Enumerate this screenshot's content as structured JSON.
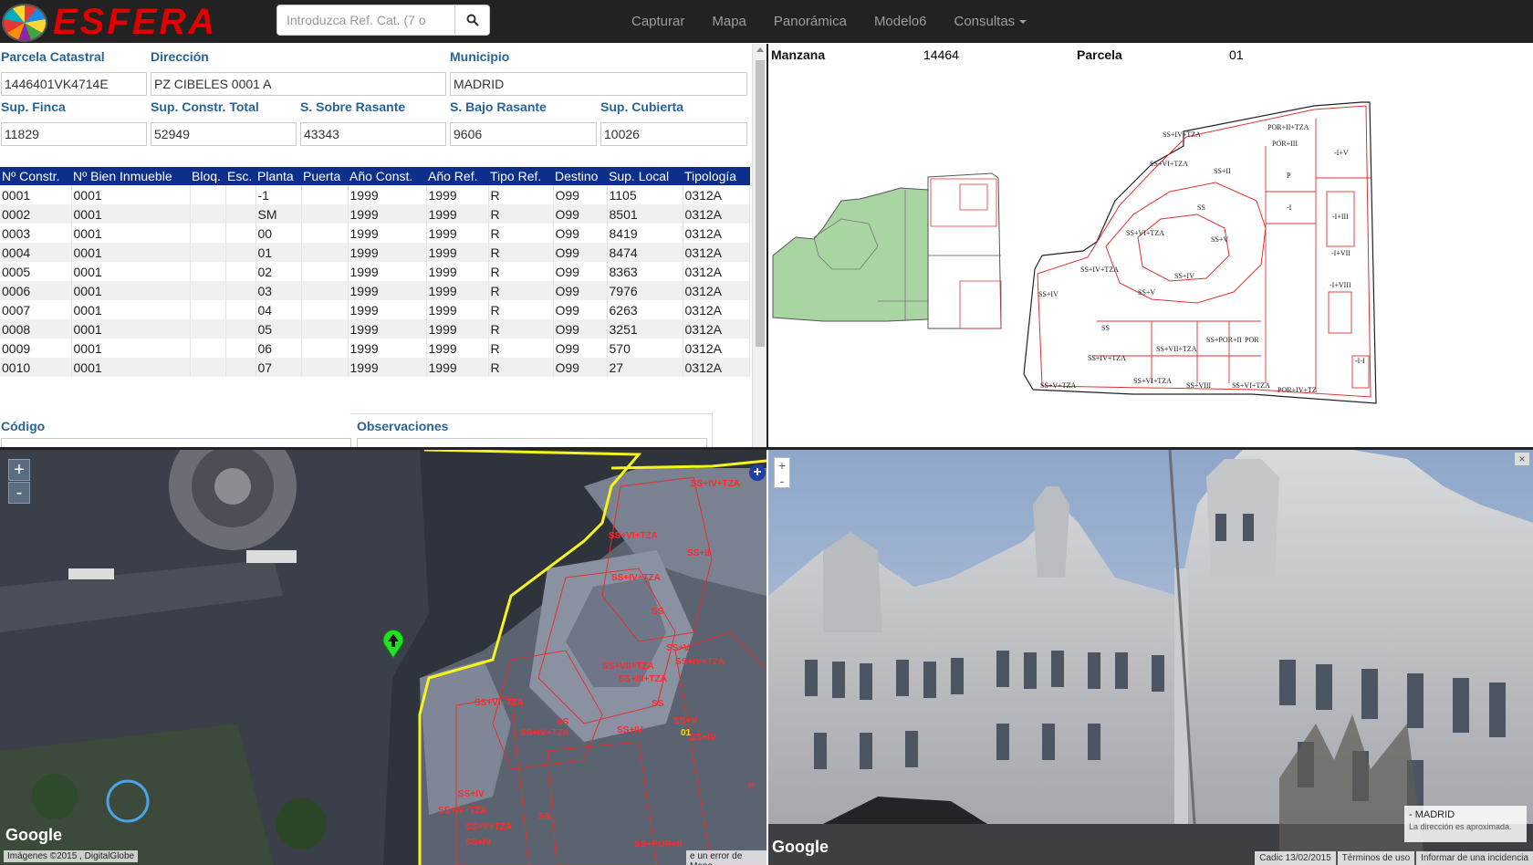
{
  "navbar": {
    "brand": "ESFERA",
    "search_placeholder": "Introduzca Ref. Cat. (7 o",
    "links": [
      "Capturar",
      "Mapa",
      "Panorámica",
      "Modelo6",
      "Consultas"
    ]
  },
  "info": {
    "parcela_catastral_label": "Parcela Catastral",
    "parcela_catastral": "1446401VK4714E",
    "direccion_label": "Dirección",
    "direccion": "PZ CIBELES 0001 A",
    "municipio_label": "Municipio",
    "municipio": "MADRID",
    "sup_finca_label": "Sup. Finca",
    "sup_finca": "11829",
    "sup_constr_total_label": "Sup. Constr. Total",
    "sup_constr_total": "52949",
    "s_sobre_rasante_label": "S. Sobre Rasante",
    "s_sobre_rasante": "43343",
    "s_bajo_rasante_label": "S. Bajo Rasante",
    "s_bajo_rasante": "9606",
    "sup_cubierta_label": "Sup. Cubierta",
    "sup_cubierta": "10026",
    "codigo_label": "Código",
    "observaciones_label": "Observaciones"
  },
  "table": {
    "headers": [
      "Nº Constr.",
      "Nº Bien Inmueble",
      "Bloq.",
      "Esc.",
      "Planta",
      "Puerta",
      "Año Const.",
      "Año Ref.",
      "Tipo Ref.",
      "Destino",
      "Sup. Local",
      "Tipología"
    ],
    "rows": [
      [
        "0001",
        "0001",
        "",
        "",
        "-1",
        "",
        "1999",
        "1999",
        "R",
        "O99",
        "1105",
        "0312A"
      ],
      [
        "0002",
        "0001",
        "",
        "",
        "SM",
        "",
        "1999",
        "1999",
        "R",
        "O99",
        "8501",
        "0312A"
      ],
      [
        "0003",
        "0001",
        "",
        "",
        "00",
        "",
        "1999",
        "1999",
        "R",
        "O99",
        "8419",
        "0312A"
      ],
      [
        "0004",
        "0001",
        "",
        "",
        "01",
        "",
        "1999",
        "1999",
        "R",
        "O99",
        "8474",
        "0312A"
      ],
      [
        "0005",
        "0001",
        "",
        "",
        "02",
        "",
        "1999",
        "1999",
        "R",
        "O99",
        "8363",
        "0312A"
      ],
      [
        "0006",
        "0001",
        "",
        "",
        "03",
        "",
        "1999",
        "1999",
        "R",
        "O99",
        "7976",
        "0312A"
      ],
      [
        "0007",
        "0001",
        "",
        "",
        "04",
        "",
        "1999",
        "1999",
        "R",
        "O99",
        "6263",
        "0312A"
      ],
      [
        "0008",
        "0001",
        "",
        "",
        "05",
        "",
        "1999",
        "1999",
        "R",
        "O99",
        "3251",
        "0312A"
      ],
      [
        "0009",
        "0001",
        "",
        "",
        "06",
        "",
        "1999",
        "1999",
        "R",
        "O99",
        "570",
        "0312A"
      ],
      [
        "0010",
        "0001",
        "",
        "",
        "07",
        "",
        "1999",
        "1999",
        "R",
        "O99",
        "27",
        "0312A"
      ]
    ]
  },
  "plan": {
    "manzana_label": "Manzana",
    "manzana": "14464",
    "parcela_label": "Parcela",
    "parcela": "01",
    "unit_labels": [
      "SS+IV+TZA",
      "POR+II+TZA",
      "SS+VI+TZA",
      "POR+III",
      "SS+II",
      "SS",
      "SS+V",
      "-I",
      "SS+IV",
      "SS+VII+TZA",
      "SS+POR+II",
      "POR",
      "SS+V+TZA",
      "SS+VIII",
      "POR+IV+TZ",
      "-I+IV",
      "-I+III",
      "-I+VII",
      "-I+VIII",
      "-I+I",
      "-I+V",
      "SS+IV+TZA"
    ]
  },
  "map": {
    "zoom_in": "+",
    "zoom_out": "-",
    "google": "Google",
    "imagery_credit": "Imágenes ©2015 , DigitalGlobe",
    "report_error": "e un error de Mapa",
    "overlay_labels": [
      "SS+IV+TZA",
      "SS+VI+TZA",
      "SS+II",
      "SS+IV+TZA",
      "SS",
      "SS+V",
      "SS+IV+TZA",
      "SS+VII+TZA",
      "SS+III+TZA",
      "SS+VI+TZA",
      "SS",
      "SS",
      "SS+IV+TZA",
      "SS+IV",
      "SS+V",
      "SS+IV",
      "SS+IV",
      "SS+IV+TZA",
      "SS+V+TZA",
      "SS+IV",
      "SS",
      "P",
      "SS+POR+II",
      "01"
    ]
  },
  "streetview": {
    "close": "×",
    "zoom_in": "+",
    "zoom_out": "-",
    "address": "- MADRID",
    "address_note": "La dirección es aproximada.",
    "google": "Google",
    "date": "Cadic 13/02/2015",
    "terms": "Términos de uso",
    "report": "Informar de una incidencia"
  }
}
